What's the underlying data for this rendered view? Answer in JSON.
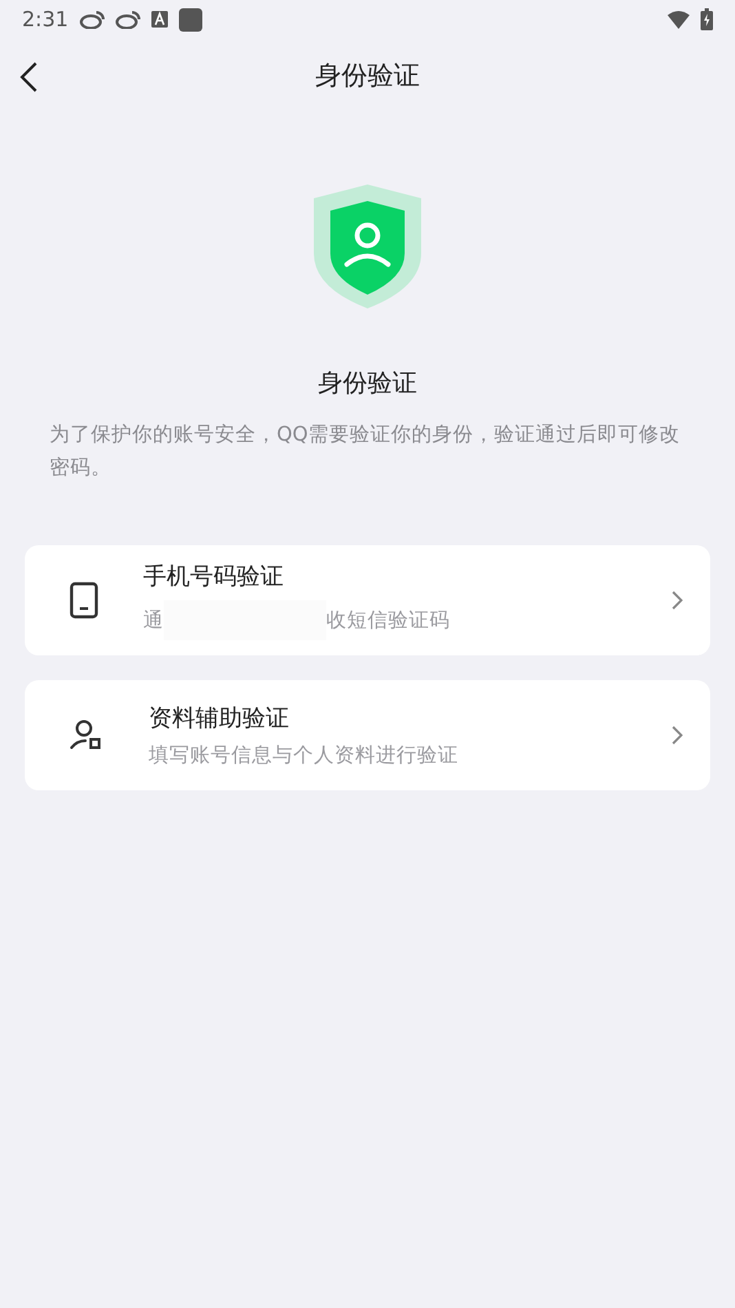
{
  "status_bar": {
    "time": "2:31"
  },
  "header": {
    "title": "身份验证"
  },
  "hero": {
    "title": "身份验证",
    "description": "为了保护你的账号安全，QQ需要验证你的身份，验证通过后即可修改密码。"
  },
  "options": [
    {
      "kind": "phone",
      "title": "手机号码验证",
      "subtitle_start": "通",
      "redacted": true,
      "subtitle_end": "收短信验证码"
    },
    {
      "kind": "profile",
      "title": "资料辅助验证",
      "subtitle_start": "填写账号信息与个人资料进行验证",
      "redacted": false
    }
  ]
}
